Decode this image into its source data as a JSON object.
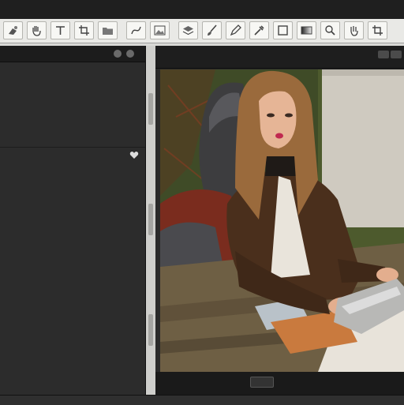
{
  "window": {
    "title": "",
    "title_visible": false
  },
  "toolbar": {
    "tools": [
      {
        "name": "paint-tool",
        "icon": "paint-icon"
      },
      {
        "name": "hand-tool",
        "icon": "hand-icon"
      },
      {
        "name": "text-tool",
        "icon": "text-icon"
      },
      {
        "name": "crop-tool",
        "icon": "crop-icon"
      },
      {
        "name": "folder-tool",
        "icon": "folder-icon"
      },
      {
        "name": "curve-tool",
        "icon": "curve-icon"
      },
      {
        "name": "image-tool",
        "icon": "image-icon"
      },
      {
        "name": "layers-tool",
        "icon": "layers-icon"
      },
      {
        "name": "brush-tool",
        "icon": "brush-icon"
      },
      {
        "name": "pen-tool",
        "icon": "pen-icon"
      },
      {
        "name": "eyedropper-tool",
        "icon": "eyedropper-icon"
      },
      {
        "name": "shape-tool",
        "icon": "shape-icon"
      },
      {
        "name": "gradient-tool",
        "icon": "gradient-icon"
      },
      {
        "name": "zoom-tool",
        "icon": "zoom-icon"
      }
    ]
  },
  "left_panel": {
    "title": "",
    "rows": [
      "",
      "",
      "",
      "",
      "",
      "",
      "",
      "",
      "",
      "",
      "",
      "",
      ""
    ]
  },
  "canvas": {
    "title": "",
    "image_subject": "illustration",
    "signature": ""
  },
  "colors": {
    "dark_panel": "#2c2c2c",
    "toolbar_bg": "#e9e9e6",
    "canvas_bg": "#2a2a2a"
  }
}
